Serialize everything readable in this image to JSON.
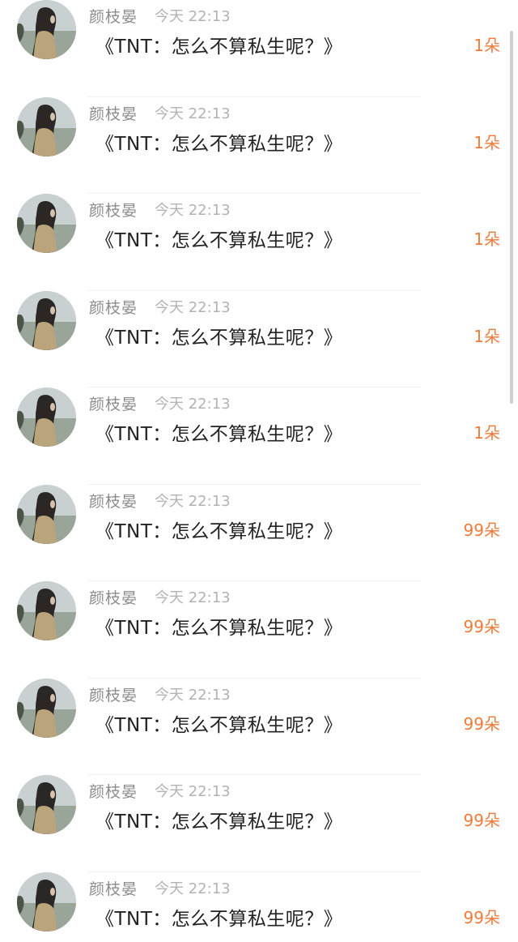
{
  "colors": {
    "username": "#8c8c8c",
    "time": "#b3b3b3",
    "message": "#222222",
    "gift": "#f07b38",
    "divider": "#f2f2f2"
  },
  "rows": [
    {
      "username": "颜枝晏",
      "time": "今天 22:13",
      "message": "《TNT：怎么不算私生呢？》",
      "gift": "1朵",
      "avatar_icon": "girl-profile-avatar"
    },
    {
      "username": "颜枝晏",
      "time": "今天 22:13",
      "message": "《TNT：怎么不算私生呢？》",
      "gift": "1朵",
      "avatar_icon": "girl-profile-avatar"
    },
    {
      "username": "颜枝晏",
      "time": "今天 22:13",
      "message": "《TNT：怎么不算私生呢？》",
      "gift": "1朵",
      "avatar_icon": "girl-profile-avatar"
    },
    {
      "username": "颜枝晏",
      "time": "今天 22:13",
      "message": "《TNT：怎么不算私生呢？》",
      "gift": "1朵",
      "avatar_icon": "girl-profile-avatar"
    },
    {
      "username": "颜枝晏",
      "time": "今天 22:13",
      "message": "《TNT：怎么不算私生呢？》",
      "gift": "1朵",
      "avatar_icon": "girl-profile-avatar"
    },
    {
      "username": "颜枝晏",
      "time": "今天 22:13",
      "message": "《TNT：怎么不算私生呢？》",
      "gift": "99朵",
      "avatar_icon": "girl-profile-avatar"
    },
    {
      "username": "颜枝晏",
      "time": "今天 22:13",
      "message": "《TNT：怎么不算私生呢？》",
      "gift": "99朵",
      "avatar_icon": "girl-profile-avatar"
    },
    {
      "username": "颜枝晏",
      "time": "今天 22:13",
      "message": "《TNT：怎么不算私生呢？》",
      "gift": "99朵",
      "avatar_icon": "girl-profile-avatar"
    },
    {
      "username": "颜枝晏",
      "time": "今天 22:13",
      "message": "《TNT：怎么不算私生呢？》",
      "gift": "99朵",
      "avatar_icon": "girl-profile-avatar"
    },
    {
      "username": "颜枝晏",
      "time": "今天 22:13",
      "message": "《TNT：怎么不算私生呢？》",
      "gift": "99朵",
      "avatar_icon": "girl-profile-avatar"
    }
  ]
}
